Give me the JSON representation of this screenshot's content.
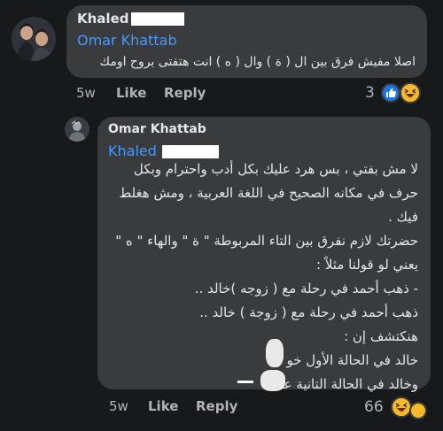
{
  "comment1": {
    "author": "Khaled",
    "mention": "Omar Khattab",
    "text": "اصلا مفيش فرق بين ال ( ة ) وال ( ه ) انت هتفتى بروح اومك",
    "time": "5w",
    "like_label": "Like",
    "reply_label": "Reply",
    "reaction_count": "3",
    "reactions": [
      "like-icon",
      "haha-icon"
    ]
  },
  "comment2": {
    "author": "Omar Khattab",
    "mention": "Khaled",
    "lines": [
      "لا مش بفتي ، بس هرد عليك بكل أدب واحترام وبكل",
      "حرف في مكانه الصحيح في اللغة العربية ، ومش هغلط",
      "فيك .",
      "حضرتك لازم نفرق بين التاء المربوطة \" ة \" والهاء \" ه \"",
      "يعني لو قولنا مثلاً :",
      "- ذهب أحمد في رحلة مع ( زوجه )خالد ..",
      "ذهب أحمد في رحلة مع ( زوجة ) خالد ..",
      "هنكتشف إن :",
      "خالد في الحالة الأول خو",
      "وخالد في الحالة التانية عـ"
    ],
    "time": "5w",
    "like_label": "Like",
    "reply_label": "Reply",
    "reaction_count": "66",
    "reactions": [
      "haha-icon"
    ]
  },
  "colors": {
    "background": "#18191a",
    "bubble": "#3a3b3c",
    "mention": "#4599ff",
    "like_blue": "#1b74e4",
    "haha_yellow": "#f7b928"
  }
}
